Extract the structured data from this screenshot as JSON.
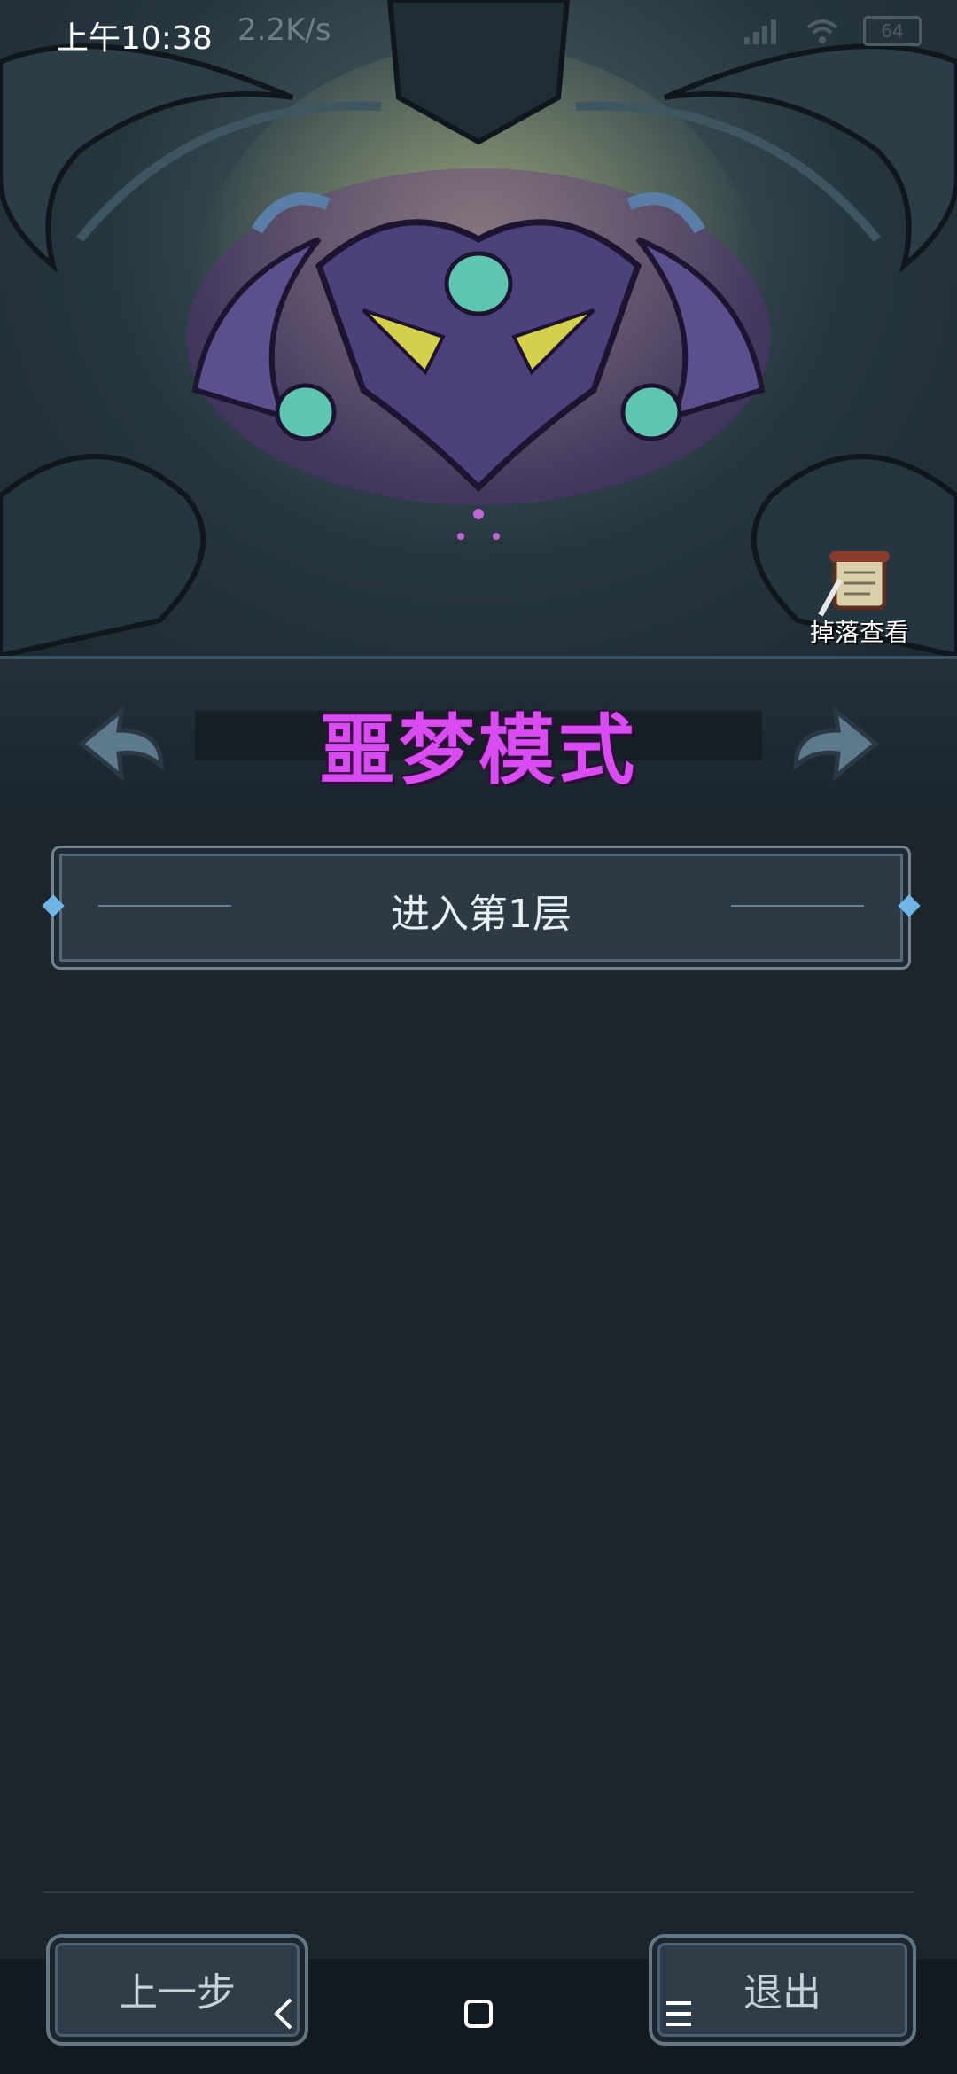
{
  "status_bar": {
    "time": "上午10:38",
    "speed": "2.2K/s",
    "battery": "64"
  },
  "header": {
    "mode_title": "噩梦模式",
    "drop_view_label": "掉落查看"
  },
  "main": {
    "enter_button_label": "进入第1层"
  },
  "footer": {
    "prev_label": "上一步",
    "exit_label": "退出"
  },
  "colors": {
    "title": "#d84cf2",
    "background": "#1c252c"
  }
}
